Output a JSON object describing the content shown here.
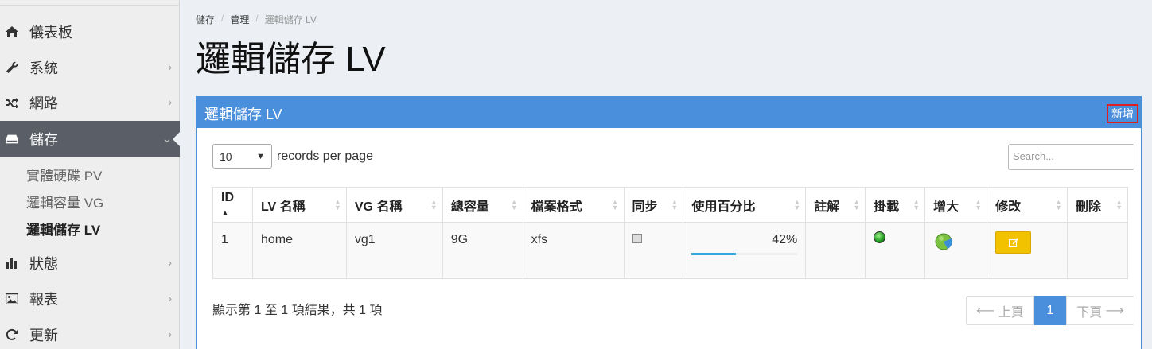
{
  "sidebar": {
    "items": [
      {
        "label": "儀表板",
        "icon": "home-icon"
      },
      {
        "label": "系統",
        "icon": "wrench-icon"
      },
      {
        "label": "網路",
        "icon": "shuffle-icon"
      },
      {
        "label": "儲存",
        "icon": "drive-icon",
        "active": true
      },
      {
        "label": "狀態",
        "icon": "bar-chart-icon"
      },
      {
        "label": "報表",
        "icon": "image-icon"
      },
      {
        "label": "更新",
        "icon": "refresh-icon"
      }
    ],
    "subitems": [
      "實體硬碟 PV",
      "邏輯容量 VG",
      "邏輯儲存 LV"
    ]
  },
  "breadcrumb": [
    "儲存",
    "管理",
    "邏輯儲存 LV"
  ],
  "page_title": "邏輯儲存 LV",
  "panel": {
    "title": "邏輯儲存 LV",
    "add_label": "新增"
  },
  "table_controls": {
    "page_size": "10",
    "per_page_label": "records per page",
    "search_placeholder": "Search..."
  },
  "table": {
    "headers": [
      "ID",
      "LV 名稱",
      "VG 名稱",
      "總容量",
      "檔案格式",
      "同步",
      "使用百分比",
      "註解",
      "掛載",
      "增大",
      "修改",
      "刪除"
    ],
    "rows": [
      {
        "id": "1",
        "lv_name": "home",
        "vg_name": "vg1",
        "size": "9G",
        "fs": "xfs",
        "sync": false,
        "usage": "42%",
        "usage_fraction": 0.42,
        "note": "",
        "mounted": true
      }
    ]
  },
  "footer": {
    "info": "顯示第 1 至 1 項結果，共 1 項",
    "prev": "上頁",
    "page": "1",
    "next": "下頁"
  },
  "colors": {
    "primary": "#4a8fdc",
    "edit": "#f2c200",
    "progress": "#35a8e0"
  }
}
